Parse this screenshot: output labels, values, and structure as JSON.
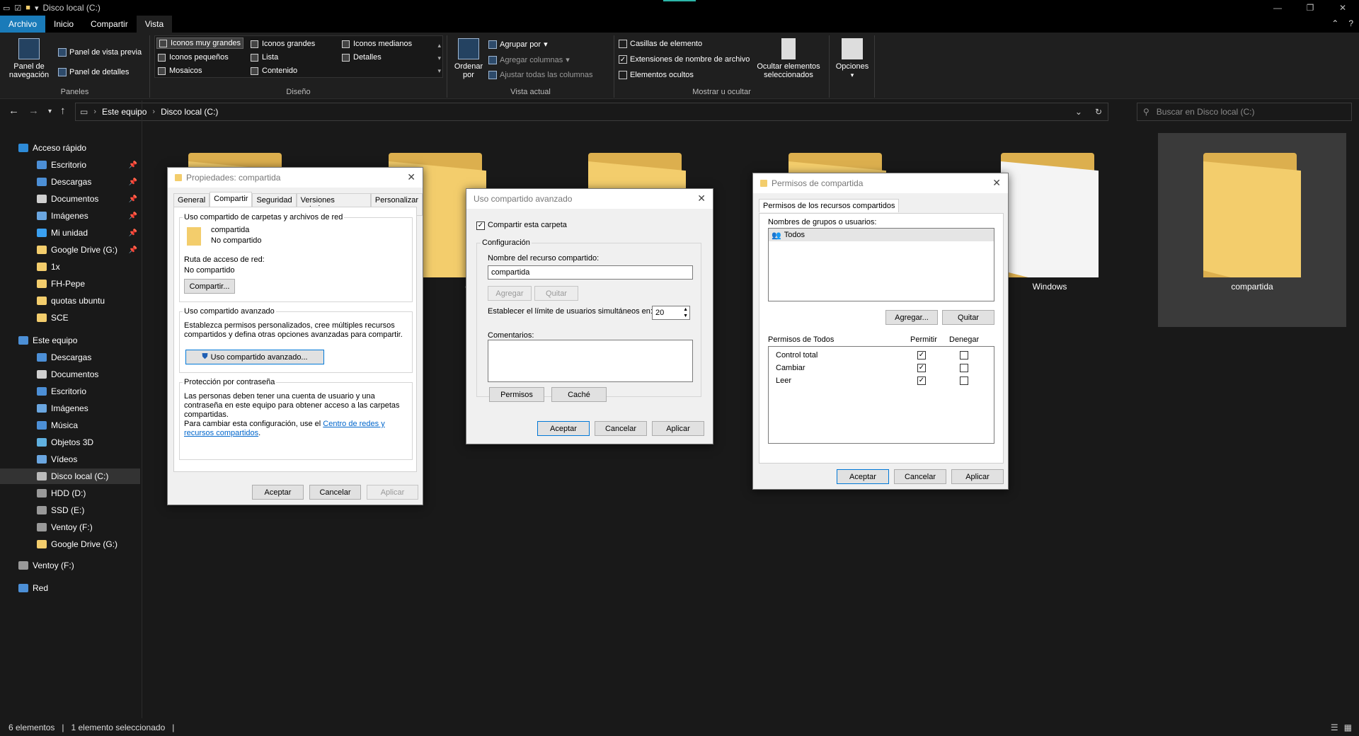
{
  "window": {
    "title": "Disco local (C:)"
  },
  "ribbon_tabs": [
    "Archivo",
    "Inicio",
    "Compartir",
    "Vista"
  ],
  "ribbon": {
    "paneles": {
      "nav_pane": "Panel de navegación",
      "preview": "Panel de vista previa",
      "details": "Panel de detalles",
      "label": "Paneles"
    },
    "diseno": {
      "items": [
        "Iconos muy grandes",
        "Iconos grandes",
        "Iconos medianos",
        "Iconos pequeños",
        "Lista",
        "Detalles",
        "Mosaicos",
        "Contenido"
      ],
      "label": "Diseño"
    },
    "vista_actual": {
      "sort": "Ordenar por",
      "group": "Agrupar por",
      "add_cols": "Agregar columnas",
      "fit_cols": "Ajustar todas las columnas",
      "label": "Vista actual"
    },
    "mostrar": {
      "checkboxes": "Casillas de elemento",
      "extensions": "Extensiones de nombre de archivo",
      "hidden": "Elementos ocultos",
      "hide_selected": "Ocultar elementos seleccionados",
      "label": "Mostrar u ocultar"
    },
    "opciones": "Opciones"
  },
  "address": {
    "crumbs": [
      "Este equipo",
      "Disco local (C:)"
    ]
  },
  "search": {
    "placeholder": "Buscar en Disco local (C:)"
  },
  "sidebar": {
    "quick_access": "Acceso rápido",
    "quick_items": [
      "Escritorio",
      "Descargas",
      "Documentos",
      "Imágenes",
      "Mi unidad",
      "Google Drive (G:)",
      "1x",
      "FH-Pepe",
      "quotas ubuntu",
      "SCE"
    ],
    "this_pc": "Este equipo",
    "pc_items": [
      "Descargas",
      "Documentos",
      "Escritorio",
      "Imágenes",
      "Música",
      "Objetos 3D",
      "Vídeos",
      "Disco local (C:)",
      "HDD (D:)",
      "SSD (E:)",
      "Ventoy (F:)",
      "Google Drive (G:)"
    ],
    "ventoy": "Ventoy (F:)",
    "network": "Red"
  },
  "content": {
    "partial_label": "os de progr",
    "windows_label": "Windows",
    "selected_label": "compartida"
  },
  "props_dialog": {
    "title": "Propiedades: compartida",
    "tabs": [
      "General",
      "Compartir",
      "Seguridad",
      "Versiones anteriores",
      "Personalizar"
    ],
    "net_section": "Uso compartido de carpetas y archivos de red",
    "folder_name": "compartida",
    "share_state": "No compartido",
    "net_path_label": "Ruta de acceso de red:",
    "net_path_value": "No compartido",
    "share_btn": "Compartir...",
    "adv_section": "Uso compartido avanzado",
    "adv_desc": "Establezca permisos personalizados, cree múltiples recursos compartidos y defina otras opciones avanzadas para compartir.",
    "adv_btn": "Uso compartido avanzado...",
    "pwd_section": "Protección por contraseña",
    "pwd_desc": "Las personas deben tener una cuenta de usuario y una contraseña en este equipo para obtener acceso a las carpetas compartidas.",
    "pwd_change": "Para cambiar esta configuración, use el",
    "pwd_link": "Centro de redes y recursos compartidos",
    "ok": "Aceptar",
    "cancel": "Cancelar",
    "apply": "Aplicar"
  },
  "adv_dialog": {
    "title": "Uso compartido avanzado",
    "share_folder": "Compartir esta carpeta",
    "config": "Configuración",
    "share_name_label": "Nombre del recurso compartido:",
    "share_name_value": "compartida",
    "add": "Agregar",
    "remove": "Quitar",
    "limit_label": "Establecer el límite de usuarios simultáneos en:",
    "limit_value": "20",
    "comments": "Comentarios:",
    "perms": "Permisos",
    "cache": "Caché",
    "ok": "Aceptar",
    "cancel": "Cancelar",
    "apply": "Aplicar"
  },
  "perm_dialog": {
    "title": "Permisos de compartida",
    "tab": "Permisos de los recursos compartidos",
    "groups_label": "Nombres de grupos o usuarios:",
    "group": "Todos",
    "add": "Agregar...",
    "remove": "Quitar",
    "perms_for": "Permisos de Todos",
    "allow": "Permitir",
    "deny": "Denegar",
    "rows": [
      {
        "name": "Control total",
        "allow": true,
        "deny": false
      },
      {
        "name": "Cambiar",
        "allow": true,
        "deny": false
      },
      {
        "name": "Leer",
        "allow": true,
        "deny": false
      }
    ],
    "ok": "Aceptar",
    "cancel": "Cancelar",
    "apply": "Aplicar"
  },
  "status": {
    "count": "6 elementos",
    "selected": "1 elemento seleccionado"
  }
}
